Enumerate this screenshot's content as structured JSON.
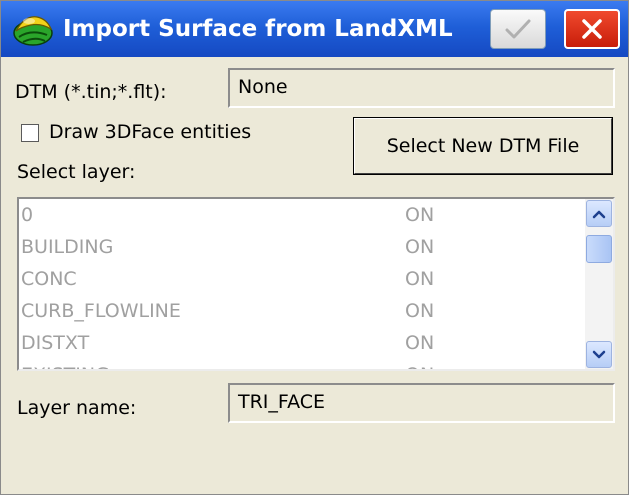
{
  "window": {
    "title": "Import Surface from LandXML",
    "icons": {
      "app": "app-logo-icon",
      "ok": "checkmark-icon",
      "close": "close-icon"
    },
    "colors": {
      "titlebar": "#1f5fd8",
      "close": "#d82a10"
    }
  },
  "dtm": {
    "label": "DTM (*.tin;*.flt):",
    "value": "None"
  },
  "draw_3dface": {
    "label": "Draw 3DFace entities",
    "checked": false
  },
  "select_dtm_button": {
    "label": "Select New DTM File"
  },
  "select_layer": {
    "label": "Select layer:"
  },
  "layers": [
    {
      "name": "0",
      "state": "ON"
    },
    {
      "name": "BUILDING",
      "state": "ON"
    },
    {
      "name": "CONC",
      "state": "ON"
    },
    {
      "name": "CURB_FLOWLINE",
      "state": "ON"
    },
    {
      "name": "DISTXT",
      "state": "ON"
    },
    {
      "name": "EXISTING",
      "state": "ON"
    }
  ],
  "layer_name": {
    "label": "Layer name:",
    "value": "TRI_FACE"
  }
}
